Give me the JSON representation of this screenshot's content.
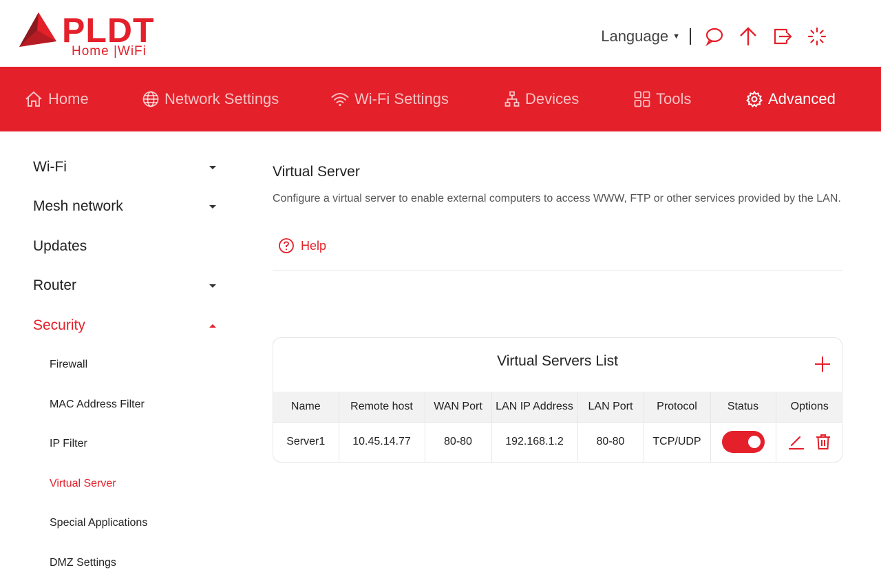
{
  "brand": {
    "name": "PLDT",
    "tagline": "Home |WiFi",
    "color": "#e4202a"
  },
  "header": {
    "language_label": "Language",
    "icons": [
      "chat-icon",
      "upload-arrow-icon",
      "logout-icon",
      "loading-icon"
    ]
  },
  "nav": [
    {
      "label": "Home",
      "icon": "home-icon"
    },
    {
      "label": "Network Settings",
      "icon": "globe-icon"
    },
    {
      "label": "Wi-Fi Settings",
      "icon": "wifi-icon"
    },
    {
      "label": "Devices",
      "icon": "devices-icon"
    },
    {
      "label": "Tools",
      "icon": "tools-icon"
    },
    {
      "label": "Advanced",
      "icon": "gear-icon",
      "active": true
    }
  ],
  "sidebar": {
    "items": [
      {
        "label": "Wi-Fi",
        "expandable": true
      },
      {
        "label": "Mesh network",
        "expandable": true
      },
      {
        "label": "Updates",
        "expandable": false
      },
      {
        "label": "Router",
        "expandable": true
      },
      {
        "label": "Security",
        "expandable": true,
        "expanded": true,
        "active": true
      }
    ],
    "security_sub": [
      {
        "label": "Firewall"
      },
      {
        "label": "MAC Address Filter"
      },
      {
        "label": "IP Filter"
      },
      {
        "label": "Virtual Server",
        "active": true
      },
      {
        "label": "Special Applications"
      },
      {
        "label": "DMZ Settings"
      }
    ]
  },
  "main": {
    "title": "Virtual Server",
    "description": "Configure a virtual server to enable external computers to access WWW, FTP or other services provided by the LAN.",
    "help_label": "Help",
    "list": {
      "title": "Virtual Servers List",
      "columns": [
        "Name",
        "Remote host",
        "WAN Port",
        "LAN IP Address",
        "LAN Port",
        "Protocol",
        "Status",
        "Options"
      ],
      "rows": [
        {
          "name": "Server1",
          "remote_host": "10.45.14.77",
          "wan_port": "80-80",
          "lan_ip": "192.168.1.2",
          "lan_port": "80-80",
          "protocol": "TCP/UDP",
          "status_enabled": true
        }
      ]
    }
  }
}
